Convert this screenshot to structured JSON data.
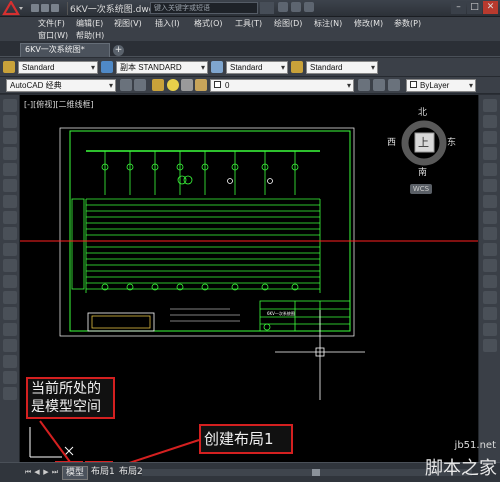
{
  "window": {
    "doc_title": "6KV一次系统图.dwg",
    "search_placeholder": "键入关键字或短语"
  },
  "menu": {
    "row1": [
      "文件(F)",
      "编辑(E)",
      "视图(V)",
      "插入(I)",
      "格式(O)",
      "工具(T)",
      "绘图(D)",
      "标注(N)",
      "修改(M)",
      "参数(P)"
    ],
    "row2": [
      "窗口(W)",
      "帮助(H)"
    ]
  },
  "tabs": {
    "file_tab": "6KV一次系统图*"
  },
  "styles": {
    "text_style": "Standard",
    "dim_style": "副本 STANDARD",
    "table_style": "Standard",
    "mleader_style": "Standard"
  },
  "workspace": {
    "name": "AutoCAD 经典",
    "layer": "0",
    "color": "ByLayer"
  },
  "viewport": {
    "label": "[-][俯视][二维线框]"
  },
  "viewcube": {
    "top": "上",
    "north": "北",
    "south": "南",
    "east": "东",
    "west": "西",
    "wcs": "WCS"
  },
  "drawing": {
    "title_block_text": "6KV一次系统图"
  },
  "layout_tabs": {
    "model": "模型",
    "layout1": "布局1",
    "layout2": "布局2"
  },
  "callouts": {
    "model_space": "当前所处的是模型空间",
    "create_layout": "创建布局1"
  },
  "watermark": {
    "site": "jb51.net",
    "name": "脚本之家"
  },
  "colors": {
    "callout_border": "#d42020",
    "drawing_lines": "#3cff3c",
    "cursor_line": "#ff2020",
    "canvas": "#000000"
  }
}
